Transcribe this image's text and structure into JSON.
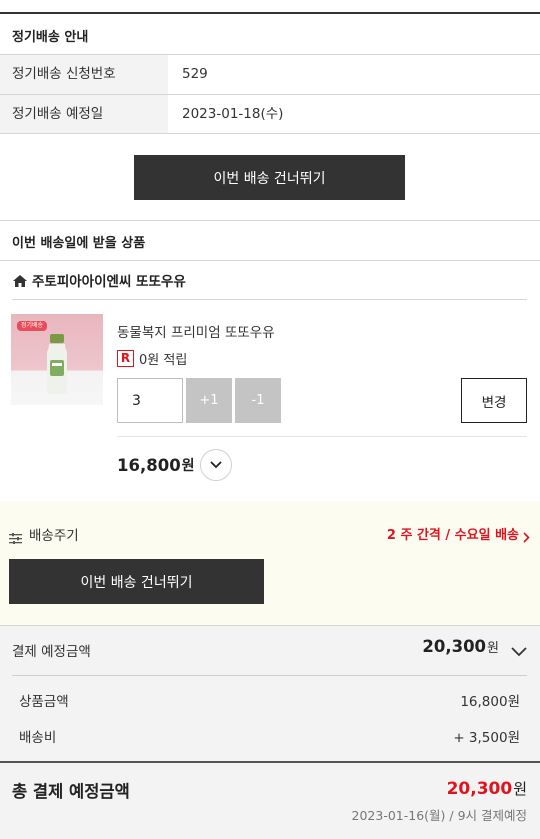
{
  "info": {
    "title": "정기배송 안내",
    "rows": [
      {
        "label": "정기배송 신청번호",
        "value": "529"
      },
      {
        "label": "정기배송 예정일",
        "value": "2023-01-18(수)"
      }
    ],
    "skip_label": "이번 배송 건너뛰기"
  },
  "products": {
    "title": "이번 배송일에 받을 상품",
    "seller": "주토피아아이엔씨 또또우유",
    "item": {
      "name": "동물복지 프리미엄 또또우유",
      "image_badge": "정기배송",
      "reward_badge": "R",
      "reward_text": "0원 적립",
      "quantity": "3",
      "plus_label": "+1",
      "minus_label": "-1",
      "change_label": "변경",
      "price": "16,800",
      "price_unit": "원"
    }
  },
  "cycle": {
    "label": "배송주기",
    "value": "2 주 간격 / 수요일 배송",
    "skip_label": "이번 배송 건너뛰기",
    "accent": "#e0141e"
  },
  "payment": {
    "label": "결제 예정금액",
    "amount": "20,300",
    "unit": "원",
    "lines": [
      {
        "label": "상품금액",
        "value": "16,800원"
      },
      {
        "label": "배송비",
        "value": "+ 3,500원"
      }
    ],
    "total_label": "총 결제 예정금액",
    "total_amount": "20,300",
    "total_unit": "원",
    "schedule": "2023-01-16(월) / 9시 결제예정"
  }
}
